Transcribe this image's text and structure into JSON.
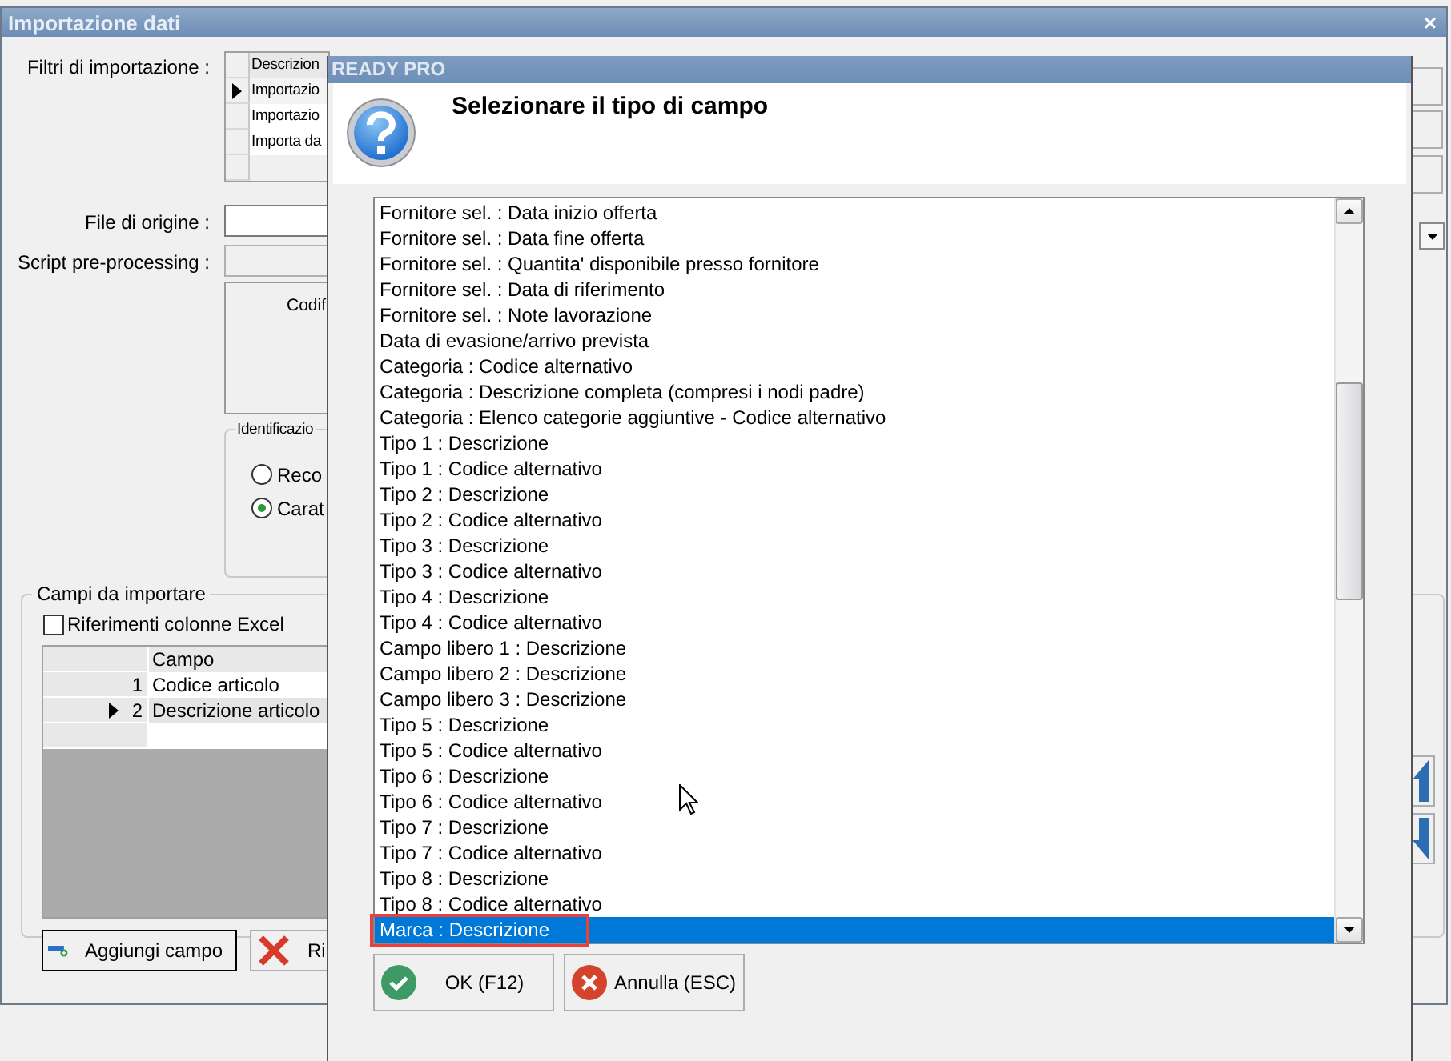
{
  "main_window": {
    "title": "Importazione dati",
    "close": "×",
    "filters": {
      "label": "Filtri di importazione :",
      "header": "Descrizion",
      "rows": [
        {
          "text": "Importazio",
          "selected": true
        },
        {
          "text": "Importazio",
          "selected": false
        },
        {
          "text": "Importa da",
          "selected": false
        }
      ]
    },
    "source_file": {
      "label": "File di origine :"
    },
    "script": {
      "label": "Script pre-processing :"
    },
    "encoding_label": "Codif",
    "identification": {
      "title": "Identificazio",
      "options": [
        {
          "label": "Reco",
          "selected": false
        },
        {
          "label": "Carat",
          "selected": true
        }
      ]
    },
    "fields_group": {
      "title": "Campi da importare",
      "excel_refs": {
        "label": "Riferimenti colonne Excel",
        "checked": false
      },
      "column": "Campo",
      "rows": [
        {
          "number": "1",
          "value": "Codice articolo",
          "selected": false
        },
        {
          "number": "2",
          "value": "Descrizione articolo",
          "selected": true
        }
      ],
      "buttons": [
        {
          "label": "Aggiungi campo",
          "kind": "add"
        },
        {
          "label": "Ri",
          "kind": "remove"
        }
      ]
    }
  },
  "dialog": {
    "title": "READY PRO",
    "heading": "Selezionare il tipo di campo",
    "items": [
      {
        "label": "Fornitore sel. : Data inizio offerta",
        "selected": false
      },
      {
        "label": "Fornitore sel. : Data fine offerta",
        "selected": false
      },
      {
        "label": "Fornitore sel. : Quantita' disponibile presso fornitore",
        "selected": false
      },
      {
        "label": "Fornitore sel. : Data di riferimento",
        "selected": false
      },
      {
        "label": "Fornitore sel. : Note lavorazione",
        "selected": false
      },
      {
        "label": "Data di evasione/arrivo prevista",
        "selected": false
      },
      {
        "label": "Categoria : Codice alternativo",
        "selected": false
      },
      {
        "label": "Categoria : Descrizione completa (compresi i nodi padre)",
        "selected": false
      },
      {
        "label": "Categoria : Elenco categorie aggiuntive - Codice alternativo",
        "selected": false
      },
      {
        "label": "Tipo 1 : Descrizione",
        "selected": false
      },
      {
        "label": "Tipo 1 : Codice alternativo",
        "selected": false
      },
      {
        "label": "Tipo 2 : Descrizione",
        "selected": false
      },
      {
        "label": "Tipo 2 : Codice alternativo",
        "selected": false
      },
      {
        "label": "Tipo 3 : Descrizione",
        "selected": false
      },
      {
        "label": "Tipo 3 : Codice alternativo",
        "selected": false
      },
      {
        "label": "Tipo 4 : Descrizione",
        "selected": false
      },
      {
        "label": "Tipo 4 : Codice alternativo",
        "selected": false
      },
      {
        "label": "Campo libero 1 : Descrizione",
        "selected": false
      },
      {
        "label": "Campo libero 2 : Descrizione",
        "selected": false
      },
      {
        "label": "Campo libero 3 : Descrizione",
        "selected": false
      },
      {
        "label": "Tipo 5 : Descrizione",
        "selected": false
      },
      {
        "label": "Tipo 5 : Codice alternativo",
        "selected": false
      },
      {
        "label": "Tipo 6 : Descrizione",
        "selected": false
      },
      {
        "label": "Tipo 6 : Codice alternativo",
        "selected": false
      },
      {
        "label": "Tipo 7 : Descrizione",
        "selected": false
      },
      {
        "label": "Tipo 7 : Codice alternativo",
        "selected": false
      },
      {
        "label": "Tipo 8 : Descrizione",
        "selected": false
      },
      {
        "label": "Tipo 8 : Codice alternativo",
        "selected": false
      },
      {
        "label": "Marca : Descrizione",
        "selected": true
      }
    ],
    "buttons": [
      {
        "label": "OK (F12)",
        "kind": "ok"
      },
      {
        "label": "Annulla (ESC)",
        "kind": "cancel"
      }
    ]
  }
}
